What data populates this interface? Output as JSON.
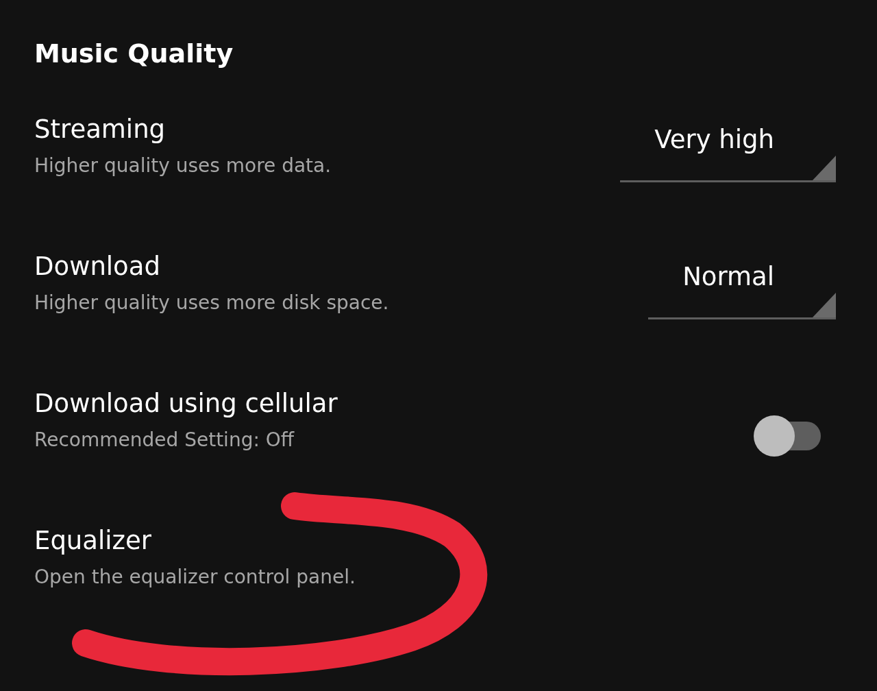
{
  "section": {
    "title": "Music Quality"
  },
  "settings": [
    {
      "kind": "dropdown",
      "title": "Streaming",
      "subtitle": "Higher quality uses more data.",
      "value": "Very high"
    },
    {
      "kind": "dropdown",
      "title": "Download",
      "subtitle": "Higher quality uses more disk space.",
      "value": "Normal"
    },
    {
      "kind": "toggle",
      "title": "Download using cellular",
      "subtitle": "Recommended Setting: Off",
      "on": false
    },
    {
      "kind": "plain",
      "title": "Equalizer",
      "subtitle": "Open the equalizer control panel."
    }
  ]
}
